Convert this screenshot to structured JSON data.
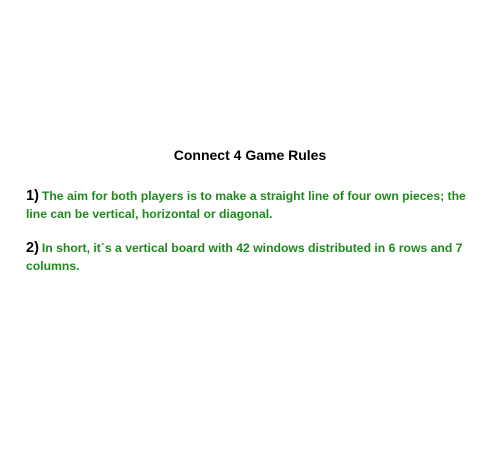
{
  "document": {
    "title": "Connect 4 Game Rules",
    "rules": [
      {
        "number": "1)",
        "text": "The aim for both players is to make a straight line of four own pieces; the line can be vertical, horizontal or diagonal."
      },
      {
        "number": "2)",
        "text": "In short, it´s a vertical board with 42 windows distributed in 6 rows and 7 columns."
      }
    ]
  },
  "colors": {
    "title": "#000000",
    "rule_number": "#000000",
    "rule_text": "#1e8a1e",
    "background": "#ffffff"
  }
}
